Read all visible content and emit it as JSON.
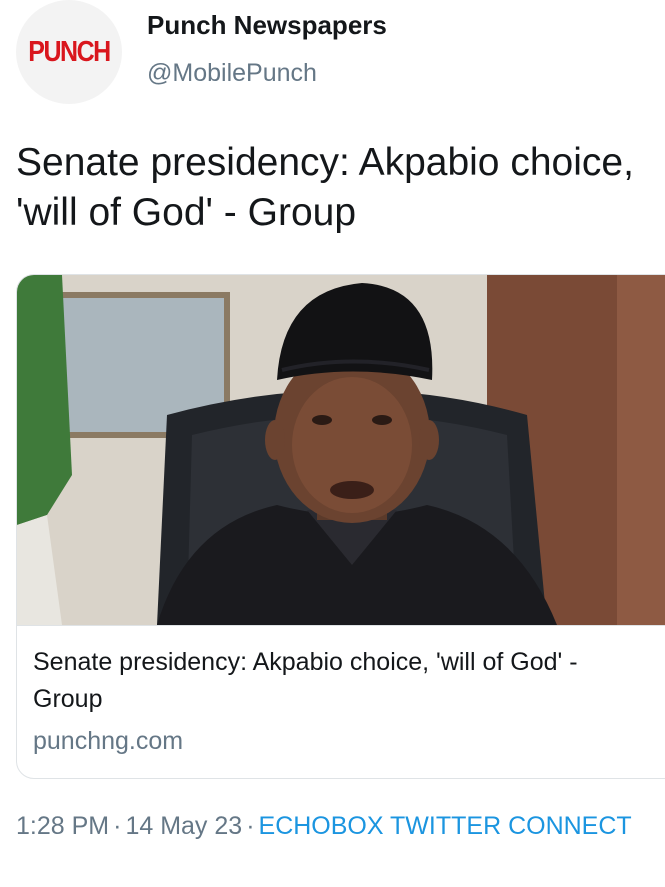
{
  "account": {
    "display_name": "Punch Newspapers",
    "handle": "@MobilePunch",
    "avatar_text": "PUNCH",
    "brand_color": "#d9161d"
  },
  "tweet": {
    "text": "Senate presidency: Akpabio choice, 'will of God' - Group"
  },
  "card": {
    "image_icon": "news-photo",
    "title": "Senate presidency: Akpabio choice, 'will of God' - Group",
    "domain": "punchng.com"
  },
  "meta": {
    "time": "1:28 PM",
    "separator": "·",
    "date": "14 May 23",
    "source": "ECHOBOX TWITTER CONNECT",
    "link_color": "#1b95e0"
  }
}
